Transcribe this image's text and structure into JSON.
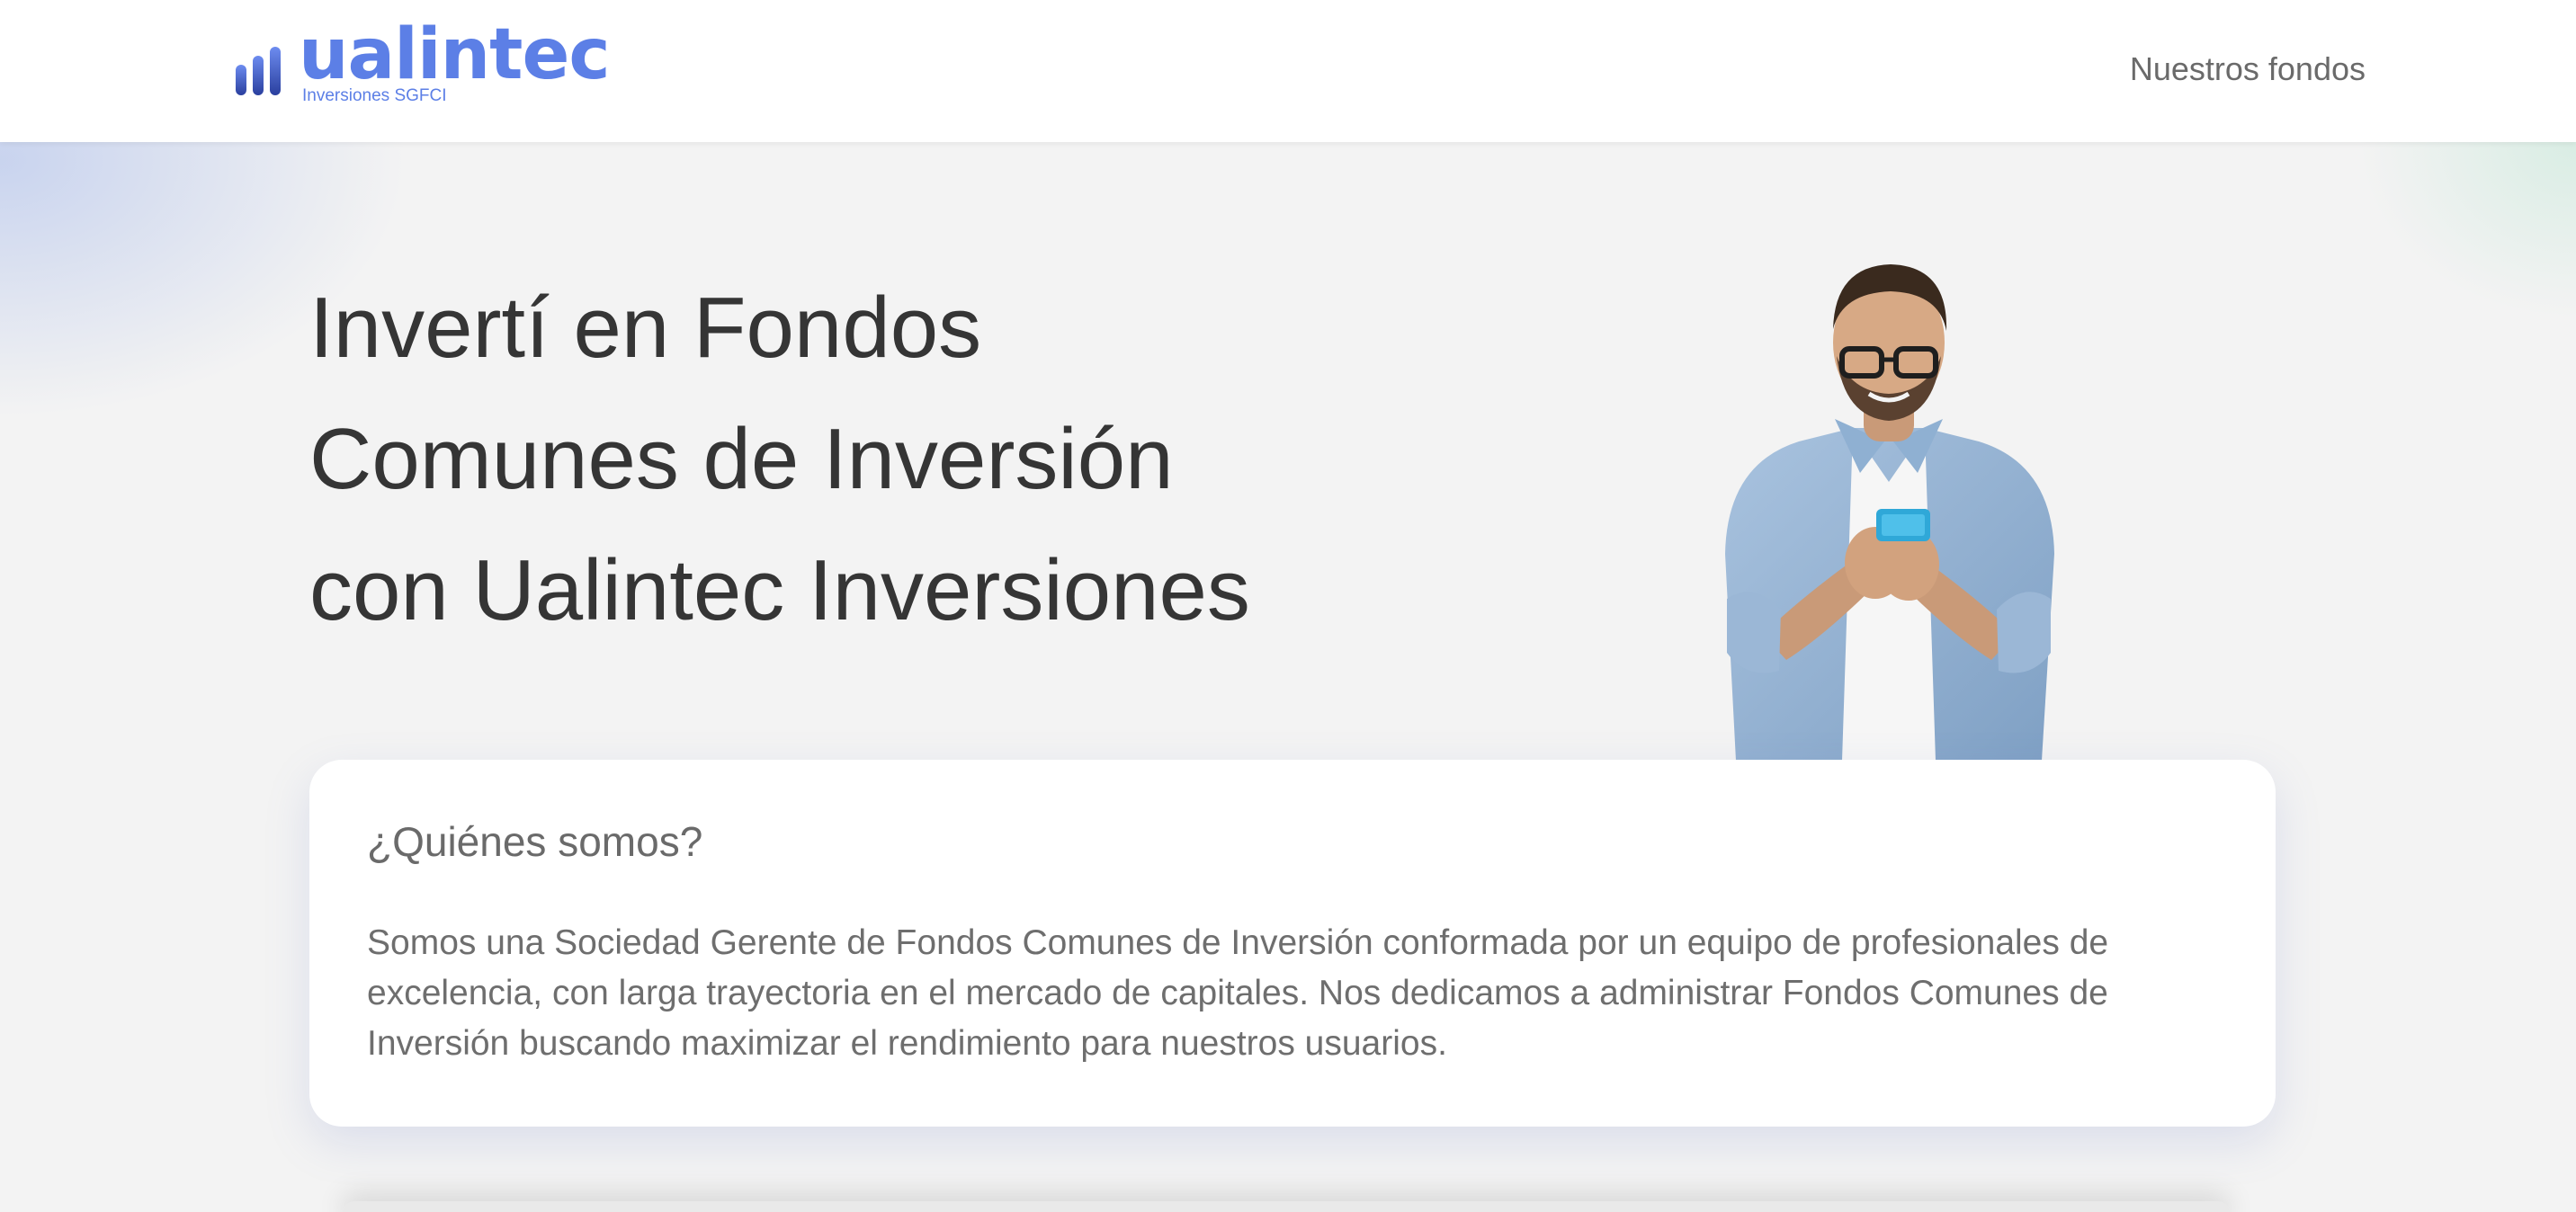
{
  "header": {
    "logo": {
      "wordmark": "ualintec",
      "tagline": "Inversiones SGFCI"
    },
    "nav": [
      {
        "label": "Nuestros fondos"
      }
    ]
  },
  "hero": {
    "title_lines": [
      "Invertí en Fondos",
      "Comunes de Inversión",
      "con Ualintec Inversiones"
    ],
    "image": "smiling-man-with-phone"
  },
  "about": {
    "title": "¿Quiénes somos?",
    "text": "Somos una Sociedad Gerente de Fondos Comunes de Inversión conformada por un equipo de profesionales de excelencia, con larga trayectoria en el mercado de capitales. Nos dedicamos a administrar Fondos Comunes de Inversión buscando maximizar el rendimiento para nuestros usuarios."
  },
  "colors": {
    "brand": "#5c7fe6",
    "brand_dark": "#2a3f9e",
    "text_dark": "#353535",
    "text_muted": "#6a6a6a",
    "background": "#f3f3f3"
  }
}
